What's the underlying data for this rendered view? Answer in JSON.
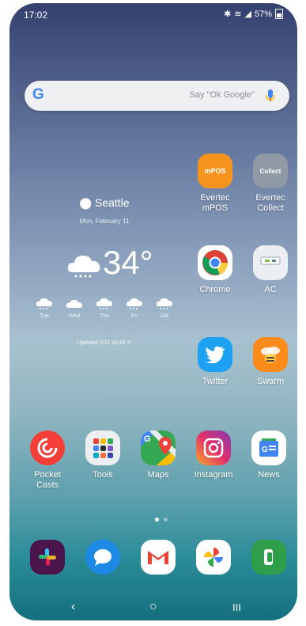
{
  "status_bar": {
    "time": "17:02",
    "battery": "57%"
  },
  "search": {
    "logo": "G",
    "placeholder": "Say \"Ok Google\"",
    "icon_mic": "mic-icon"
  },
  "weather": {
    "location": "Seattle",
    "date": "Mon, February 11",
    "temperature": "34°",
    "forecast": [
      {
        "day": "Tue",
        "icon": "snow-cloud-icon"
      },
      {
        "day": "Wed",
        "icon": "partly-cloudy-icon"
      },
      {
        "day": "Thu",
        "icon": "snow-cloud-icon"
      },
      {
        "day": "Fri",
        "icon": "snow-cloud-icon"
      },
      {
        "day": "Sat",
        "icon": "snow-cloud-icon"
      }
    ],
    "updated": "Updated 2/11 16:46"
  },
  "apps": {
    "mpos": {
      "label": "Evertec mPOS",
      "line1": "Evertec",
      "line2": "mPOS",
      "badge": "mPOS",
      "color": "#f7941d"
    },
    "collect": {
      "label": "Evertec Collect",
      "line1": "Evertec",
      "line2": "Collect",
      "badge": "Collect",
      "color": "#8f9aa6"
    },
    "chrome": {
      "label": "Chrome"
    },
    "ac": {
      "label": "AC"
    },
    "twitter": {
      "label": "Twitter",
      "color": "#1da1f2"
    },
    "swarm": {
      "label": "Swarm",
      "color": "#fb8c1b"
    },
    "pocket_casts": {
      "label": "Pocket Casts",
      "line1": "Pocket",
      "line2": "Casts",
      "color": "#f43e37"
    },
    "tools": {
      "label": "Tools"
    },
    "maps": {
      "label": "Maps"
    },
    "instagram": {
      "label": "Instagram"
    },
    "news": {
      "label": "News"
    }
  },
  "dock": [
    {
      "name": "slack-icon"
    },
    {
      "name": "messages-icon"
    },
    {
      "name": "gmail-icon"
    },
    {
      "name": "photos-icon"
    },
    {
      "name": "phone-icon"
    }
  ],
  "navbar": {
    "back": "‹",
    "home": "○",
    "recents": "III"
  }
}
